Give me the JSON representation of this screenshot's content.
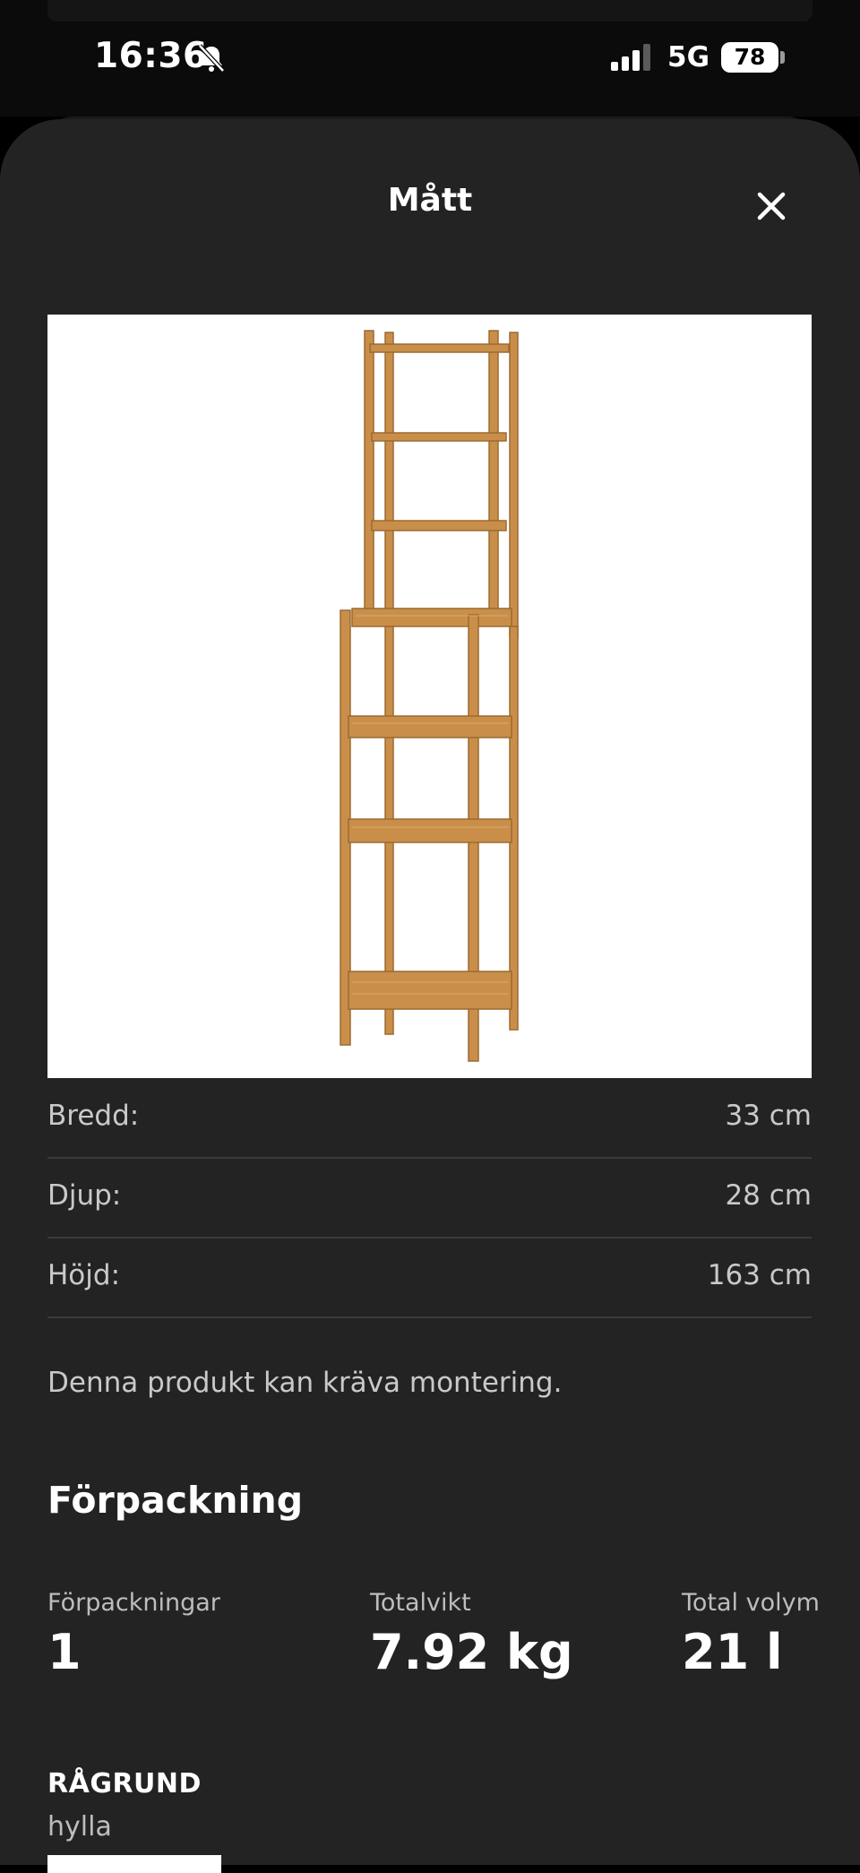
{
  "status_bar": {
    "time": "16:36",
    "network": "5G",
    "battery": "78",
    "icons": [
      "bell-off-icon",
      "signal-icon",
      "battery-icon"
    ]
  },
  "sheet": {
    "title": "Mått",
    "close_icon": "close-icon"
  },
  "product": {
    "image": "wooden-shelf-unit",
    "name": "RÅGRUND",
    "type": "hylla"
  },
  "dimensions": [
    {
      "label": "Bredd:",
      "value": "33 cm"
    },
    {
      "label": "Djup:",
      "value": "28 cm"
    },
    {
      "label": "Höjd:",
      "value": "163 cm"
    }
  ],
  "assembly_note": "Denna produkt kan kräva montering.",
  "packaging": {
    "title": "Förpackning",
    "stats": [
      {
        "label": "Förpackningar",
        "value": "1"
      },
      {
        "label": "Totalvikt",
        "value": "7.92 kg"
      },
      {
        "label": "Total volym",
        "value": "21 l"
      }
    ]
  },
  "colors": {
    "sheet_background": "#232323",
    "divider": "#3b3b3b",
    "wood": "#c98f4a"
  }
}
